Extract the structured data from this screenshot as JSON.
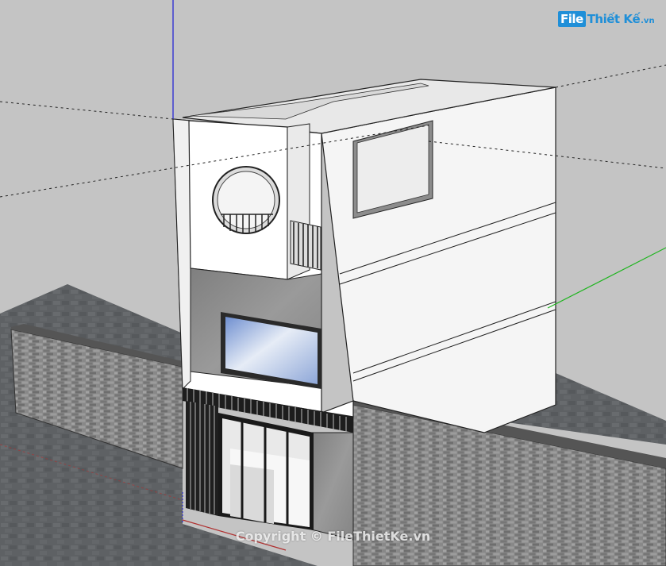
{
  "logo": {
    "brand_file": "File",
    "brand_name": "Thiết Kế",
    "brand_tld": ".vn"
  },
  "watermark": {
    "text": "Copyright © FileThietKe.vn"
  },
  "colors": {
    "background": "#c4c4c4",
    "ground": "#5f6265",
    "brick_wall": "#8a8a8a",
    "building_white": "#ffffff",
    "concrete": "#8e8e8e",
    "glass": "#9fb7dc",
    "axis_blue": "#1b1bd6",
    "axis_green": "#1fb51f",
    "axis_red": "#b03030"
  },
  "scene": {
    "description_icon": "house-3d-model-icon"
  }
}
